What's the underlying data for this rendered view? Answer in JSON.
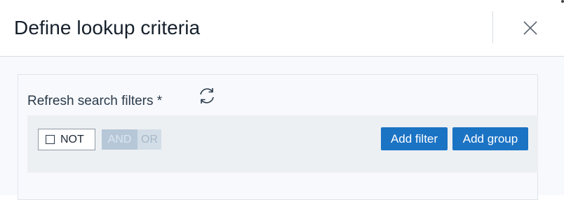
{
  "dialog": {
    "title": "Define lookup criteria",
    "close_icon": "close-icon"
  },
  "panel": {
    "refresh_label": "Refresh search filters *",
    "refresh_icon": "refresh-icon"
  },
  "filter": {
    "not_label": "NOT",
    "not_checked": false,
    "and_label": "AND",
    "or_label": "OR",
    "add_filter_label": "Add filter",
    "add_group_label": "Add group"
  },
  "colors": {
    "primary": "#1b73c4",
    "and_bg": "#b6c7d8",
    "or_bg": "#d2dde8"
  }
}
